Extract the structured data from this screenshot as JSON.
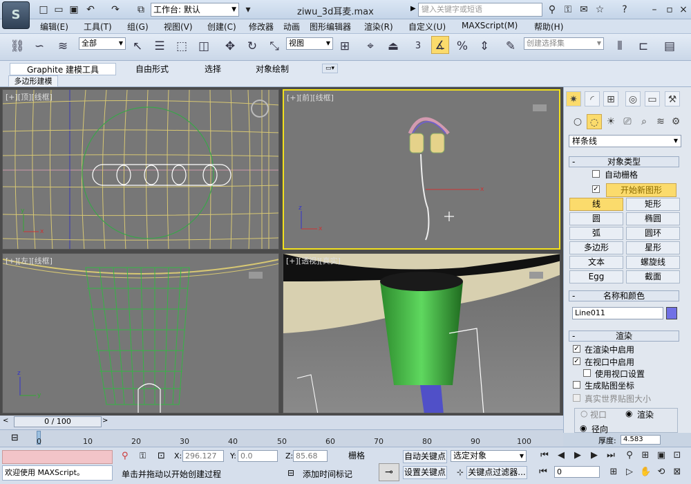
{
  "app": {
    "logo": "S"
  },
  "titlebar": {
    "workspace_label": "工作台: 默认",
    "doc_title": "ziwu_3d耳麦.max",
    "search_placeholder": "键入关键字或短语"
  },
  "menus": [
    "编辑(E)",
    "工具(T)",
    "组(G)",
    "视图(V)",
    "创建(C)",
    "修改器",
    "动画",
    "图形编辑器",
    "渲染(R)",
    "自定义(U)",
    "MAXScript(M)",
    "帮助(H)"
  ],
  "toolbar": {
    "selection_filter": "全部",
    "ref_coord": "视图",
    "angle_snap": "3",
    "named_selection_placeholder": "创建选择集"
  },
  "ribbon": {
    "tabs": [
      "Graphite 建模工具",
      "自由形式",
      "选择",
      "对象绘制"
    ],
    "subtab": "多边形建模"
  },
  "viewports": {
    "top_label": "[+][顶][线框]",
    "front_label": "[+][前][线框]",
    "left_label": "[+][左][线框]",
    "persp_label": "[+][透视][真实]"
  },
  "command_panel": {
    "category_combo": "样条线",
    "object_type_title": "对象类型",
    "autogrid_label": "自动栅格",
    "start_new_shape_label": "开始新图形",
    "buttons": [
      [
        "线",
        "矩形"
      ],
      [
        "圆",
        "椭圆"
      ],
      [
        "弧",
        "圆环"
      ],
      [
        "多边形",
        "星形"
      ],
      [
        "文本",
        "螺旋线"
      ],
      [
        "Egg",
        "截面"
      ]
    ],
    "name_color_title": "名称和颜色",
    "object_name": "Line011",
    "object_color": "#7171e6",
    "render_title": "渲染",
    "render_options": [
      "在渲染中启用",
      "在视口中启用",
      "使用视口设置",
      "生成贴图坐标",
      "真实世界贴图大小"
    ],
    "viewport_radio": "视口",
    "render_radio": "渲染",
    "radial_label": "径向",
    "thickness_label": "厚度:",
    "thickness_value": "4.583"
  },
  "timeline": {
    "slider_text": "0 / 100",
    "ticks": [
      "0",
      "10",
      "20",
      "30",
      "40",
      "50",
      "60",
      "70",
      "80",
      "90",
      "100"
    ]
  },
  "status": {
    "listener_text": "欢迎使用 MAXScript。",
    "prompt_text": "单击并拖动以开始创建过程",
    "add_time_tag": "添加时间标记",
    "x_label": "X:",
    "x_value": "296.127",
    "y_label": "Y:",
    "y_value": "0.0",
    "z_label": "Z:",
    "z_value": "85.68",
    "grid_label": "栅格",
    "auto_key_label": "自动关键点",
    "set_key_label": "设置关键点",
    "selected_combo": "选定对象",
    "key_filters_label": "关键点过滤器...",
    "frame_value": "0"
  }
}
